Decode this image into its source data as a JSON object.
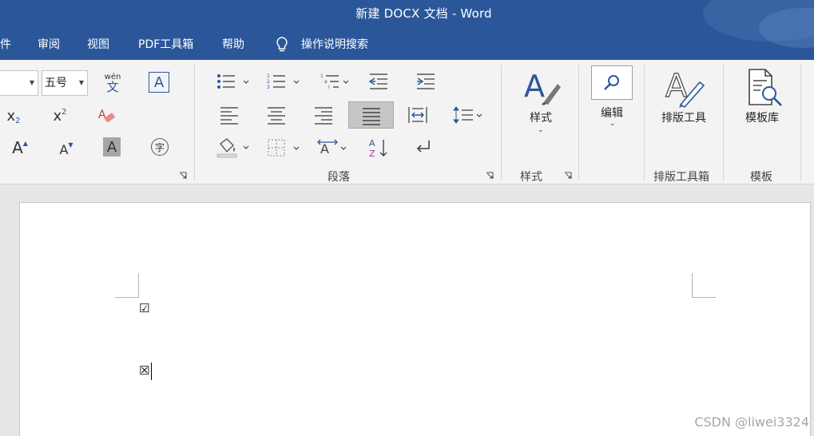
{
  "window": {
    "title": "新建 DOCX 文档 - Word"
  },
  "menu": {
    "items": [
      "件",
      "审阅",
      "视图",
      "PDF工具箱",
      "帮助"
    ],
    "search_label": "操作说明搜索"
  },
  "font_group": {
    "font_size": "五号",
    "phonetic_top": "wén",
    "phonetic_bottom": "文",
    "char_border": "A",
    "subscript_x": "x",
    "subscript_2": "2",
    "superscript_x": "x",
    "superscript_2": "2",
    "grow_font": "A",
    "shrink_font": "A",
    "char_shading": "A",
    "enclose_char": "字"
  },
  "paragraph_group": {
    "label": "段落"
  },
  "styles_group": {
    "label": "样式",
    "button_label": "样式"
  },
  "editing_group": {
    "button_label": "编辑"
  },
  "layout_tools_group": {
    "label": "排版工具箱",
    "button_label": "排版工具"
  },
  "template_group": {
    "label": "模板",
    "button_label": "模板库"
  },
  "document": {
    "checked_box": "☑",
    "crossed_box": "☒"
  },
  "watermark": "CSDN @liwei3324",
  "colors": {
    "title_bar": "#2b579a",
    "accent_blue": "#2b579a",
    "ribbon_bg": "#f3f3f3"
  }
}
